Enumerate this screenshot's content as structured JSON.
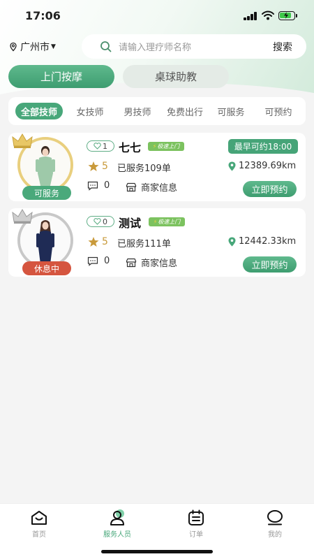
{
  "status_bar": {
    "time": "17:06"
  },
  "header": {
    "city": "广州市",
    "search_placeholder": "请输入理疗师名称",
    "search_button": "搜索"
  },
  "main_tabs": [
    {
      "label": "上门按摩",
      "active": true
    },
    {
      "label": "桌球助教",
      "active": false
    }
  ],
  "filters": [
    "全部技师",
    "女技师",
    "男技师",
    "免费出行",
    "可服务",
    "可预约"
  ],
  "therapists": [
    {
      "likes": "1",
      "name": "七七",
      "fast_tag": "极速上门",
      "earliest": "最早可约18:00",
      "rating": "5",
      "served": "已服务109单",
      "distance": "12389.69km",
      "comments": "0",
      "shop": "商家信息",
      "status": "可服务",
      "book": "立即预约"
    },
    {
      "likes": "0",
      "name": "测试",
      "fast_tag": "极速上门",
      "earliest": "",
      "rating": "5",
      "served": "已服务111单",
      "distance": "12442.33km",
      "comments": "0",
      "shop": "商家信息",
      "status": "休息中",
      "book": "立即预约"
    }
  ],
  "bottom_nav": [
    {
      "label": "首页",
      "icon": "home-icon",
      "active": false
    },
    {
      "label": "服务人员",
      "icon": "person-icon",
      "active": true
    },
    {
      "label": "订单",
      "icon": "order-icon",
      "active": false
    },
    {
      "label": "我的",
      "icon": "profile-icon",
      "active": false
    }
  ],
  "colors": {
    "accent": "#48a77a",
    "resting": "#d5553f",
    "gold": "#e9cf7e"
  }
}
